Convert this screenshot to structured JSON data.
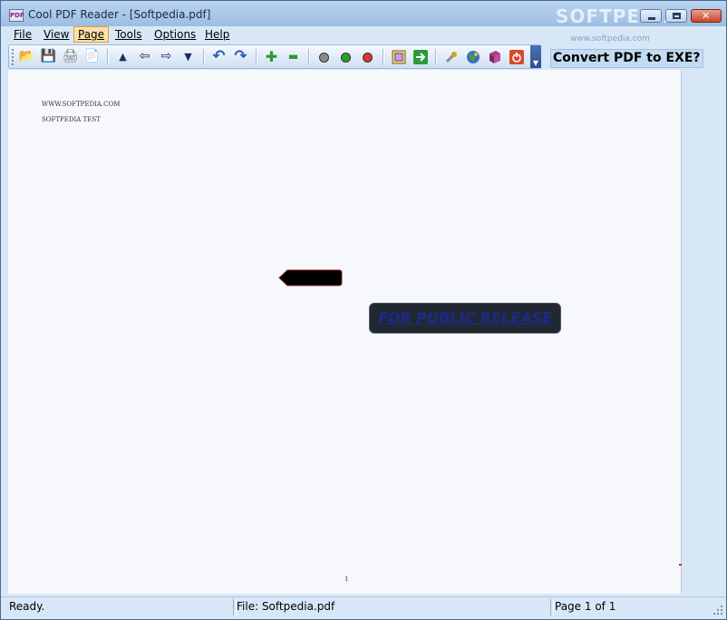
{
  "window": {
    "title": "Cool PDF Reader - [Softpedia.pdf]",
    "app_icon_text": "PDF",
    "watermark": "SOFTPEDIA",
    "watermark_sub": "www.softpedia.com",
    "close_glyph": "✕"
  },
  "menu": {
    "file": "File",
    "view": "View",
    "page": "Page",
    "tools": "Tools",
    "options": "Options",
    "help": "Help"
  },
  "toolbar": {
    "buttons": [
      {
        "name": "open-icon",
        "glyph": "📂"
      },
      {
        "name": "save-icon",
        "glyph": "💾"
      },
      {
        "name": "print-icon",
        "glyph": "🖨"
      },
      {
        "name": "copy-icon",
        "glyph": "📄"
      },
      {
        "name": "first-page-icon",
        "glyph": "▲"
      },
      {
        "name": "previous-page-icon",
        "glyph": "⇦"
      },
      {
        "name": "next-page-icon",
        "glyph": "⇨"
      },
      {
        "name": "last-page-icon",
        "glyph": "▼"
      },
      {
        "name": "rotate-left-icon",
        "glyph": "↶"
      },
      {
        "name": "rotate-right-icon",
        "glyph": "↷"
      },
      {
        "name": "zoom-in-icon",
        "glyph": "✚"
      },
      {
        "name": "zoom-out-icon",
        "glyph": "▬"
      }
    ],
    "dot_colors": {
      "gray": "#8a8a8a",
      "green": "#2aa02a",
      "red": "#d63a2a"
    },
    "promo": "Convert PDF to EXE?"
  },
  "document": {
    "line1": "WWW.SOFTPEDIA.COM",
    "line2": "SOFTPEDIA TEST",
    "stamp": "FOR PUBLIC RELEASE",
    "page_number": "1"
  },
  "status": {
    "ready": "Ready.",
    "file": "File: Softpedia.pdf",
    "page": "Page 1 of 1"
  }
}
